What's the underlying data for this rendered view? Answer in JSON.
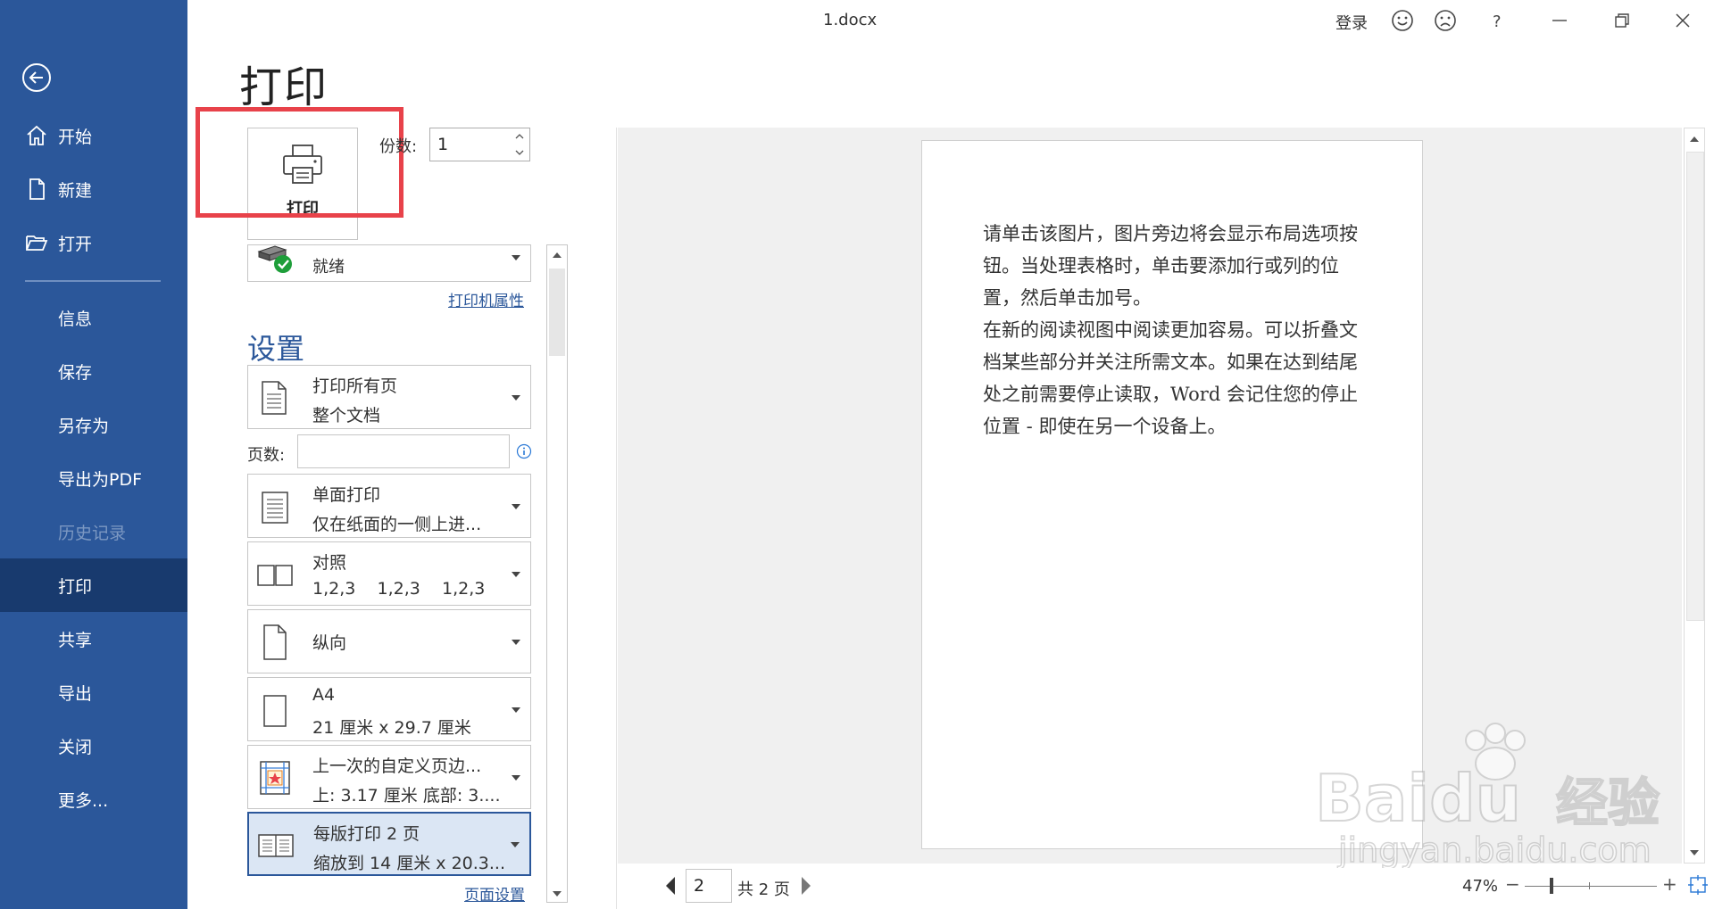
{
  "window": {
    "title": "1.docx",
    "login": "登录"
  },
  "sidebar": {
    "items": [
      {
        "label": "开始",
        "icon": "home-icon"
      },
      {
        "label": "新建",
        "icon": "new-document-icon"
      },
      {
        "label": "打开",
        "icon": "folder-open-icon"
      },
      {
        "label": "信息"
      },
      {
        "label": "保存"
      },
      {
        "label": "另存为"
      },
      {
        "label": "导出为PDF"
      },
      {
        "label": "历史记录",
        "disabled": true
      },
      {
        "label": "打印",
        "active": true
      },
      {
        "label": "共享"
      },
      {
        "label": "导出"
      },
      {
        "label": "关闭"
      },
      {
        "label": "更多..."
      }
    ]
  },
  "print": {
    "title": "打印",
    "button_label": "打印",
    "copies_label": "份数:",
    "copies_value": "1",
    "printer_status": "就绪",
    "printer_properties": "打印机属性",
    "settings_title": "设置",
    "pages_label": "页数:",
    "pages_value": "",
    "options": [
      {
        "line1": "打印所有页",
        "line2": "整个文档"
      },
      {
        "line1": "单面打印",
        "line2": "仅在纸面的一侧上进..."
      },
      {
        "line1": "对照",
        "line2": "1,2,3    1,2,3    1,2,3"
      },
      {
        "line1": "纵向"
      },
      {
        "line1": "A4",
        "line2": "21 厘米 x 29.7 厘米"
      },
      {
        "line1": "上一次的自定义页边...",
        "line2": "上: 3.17 厘米 底部: 3...."
      },
      {
        "line1": "每版打印 2 页",
        "line2": "缩放到 14 厘米 x 20.3...",
        "selected": true
      }
    ],
    "page_setup": "页面设置"
  },
  "preview": {
    "paragraphs": [
      "请单击该图片，图片旁边将会显示布局选项按钮。当处理表格时，单击要添加行或列的位置，然后单击加号。",
      "在新的阅读视图中阅读更加容易。可以折叠文档某些部分并关注所需文本。如果在达到结尾处之前需要停止读取，Word 会记住您的停止位置 - 即使在另一个设备上。"
    ],
    "current_page": "2",
    "total_pages": "共 2 页",
    "zoom": "47%",
    "zoom_fraction": 0.47
  },
  "colors": {
    "accent": "#2b579a",
    "active_nav": "#183a6e",
    "highlight": "#e8424a"
  },
  "watermark_text": [
    "Baidu",
    "经验",
    "jingyan.baidu.com"
  ]
}
